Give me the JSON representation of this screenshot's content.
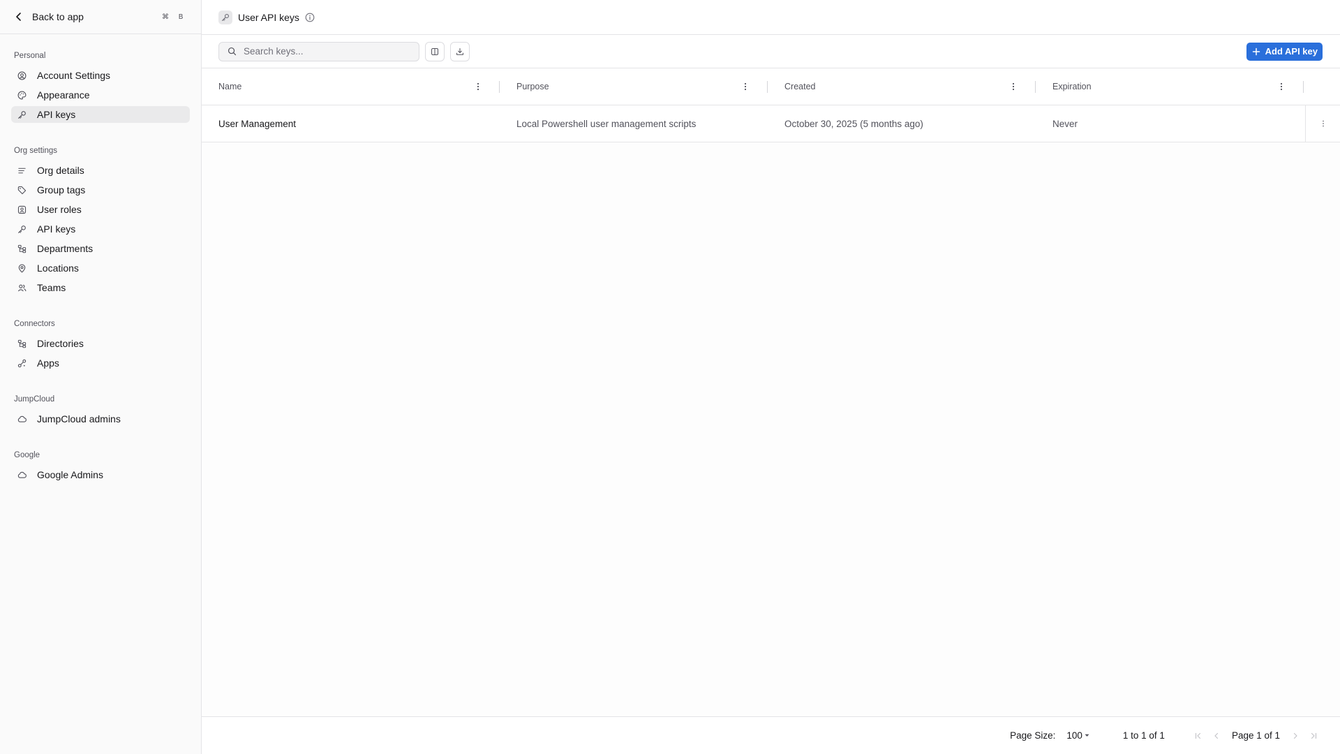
{
  "sidebar": {
    "back_label": "Back to app",
    "shortcut_keys": [
      "⌘",
      "B"
    ],
    "sections": [
      {
        "label": "Personal",
        "items": [
          {
            "label": "Account Settings",
            "icon": "account-circle-icon",
            "active": false
          },
          {
            "label": "Appearance",
            "icon": "palette-icon",
            "active": false
          },
          {
            "label": "API keys",
            "icon": "key-icon",
            "active": true
          }
        ]
      },
      {
        "label": "Org settings",
        "items": [
          {
            "label": "Org details",
            "icon": "list-icon",
            "active": false
          },
          {
            "label": "Group tags",
            "icon": "tag-icon",
            "active": false
          },
          {
            "label": "User roles",
            "icon": "roles-icon",
            "active": false
          },
          {
            "label": "API keys",
            "icon": "key-icon",
            "active": false
          },
          {
            "label": "Departments",
            "icon": "hierarchy-icon",
            "active": false
          },
          {
            "label": "Locations",
            "icon": "map-pin-icon",
            "active": false
          },
          {
            "label": "Teams",
            "icon": "users-icon",
            "active": false
          }
        ]
      },
      {
        "label": "Connectors",
        "items": [
          {
            "label": "Directories",
            "icon": "hierarchy-icon",
            "active": false
          },
          {
            "label": "Apps",
            "icon": "apps-icon",
            "active": false
          }
        ]
      },
      {
        "label": "JumpCloud",
        "items": [
          {
            "label": "JumpCloud admins",
            "icon": "cloud-icon",
            "active": false
          }
        ]
      },
      {
        "label": "Google",
        "items": [
          {
            "label": "Google Admins",
            "icon": "cloud-icon",
            "active": false
          }
        ]
      }
    ]
  },
  "header": {
    "title": "User API keys"
  },
  "toolbar": {
    "search_placeholder": "Search keys...",
    "add_label": "Add API key"
  },
  "table": {
    "columns": [
      "Name",
      "Purpose",
      "Created",
      "Expiration"
    ],
    "rows": [
      {
        "name": "User Management",
        "purpose": "Local Powershell user management scripts",
        "created": "October 30, 2025 (5 months ago)",
        "expiration": "Never"
      }
    ]
  },
  "footer": {
    "page_size_label": "Page Size:",
    "page_size_value": "100",
    "range_text": "1 to 1 of 1",
    "page_text": "Page 1 of 1"
  },
  "colors": {
    "accent": "#2a6fdb",
    "sidebar_bg": "#fafafa",
    "active_item_bg": "#eaeaeb",
    "border": "#e4e4e7"
  }
}
